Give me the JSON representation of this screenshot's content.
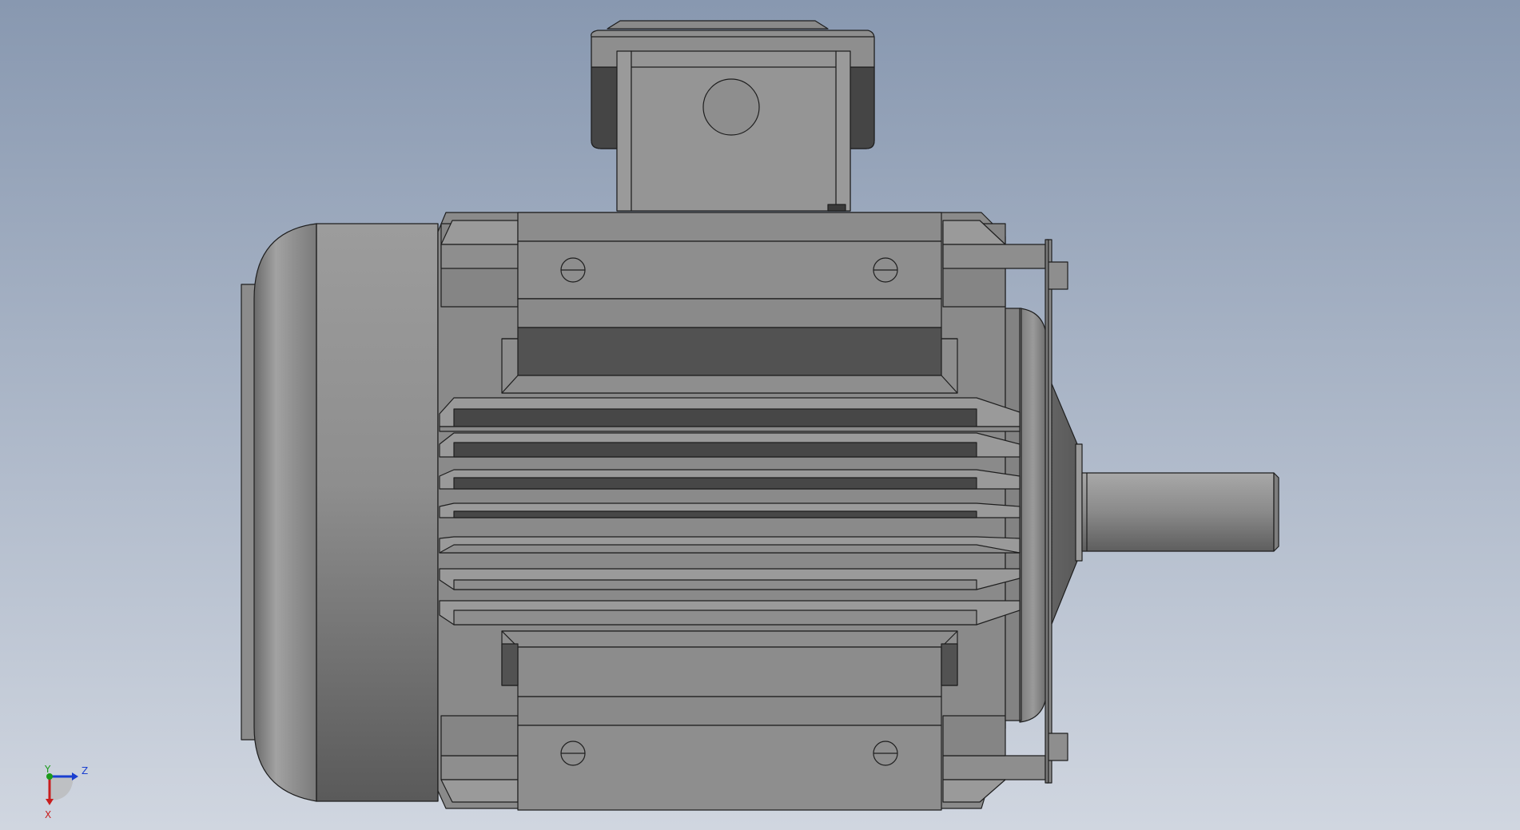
{
  "viewport": {
    "background_top": "#8898b0",
    "background_bottom": "#d0d6e0"
  },
  "model": {
    "body_color": "#8c8c8c",
    "dark_color": "#4e4e4e",
    "edge_color": "#1e1e1e"
  },
  "triad": {
    "y_label": "Y",
    "z_label": "Z",
    "x_label": "X",
    "y_color": "#1a9a1a",
    "z_color": "#1a3fd0",
    "x_color": "#c81e1e"
  }
}
